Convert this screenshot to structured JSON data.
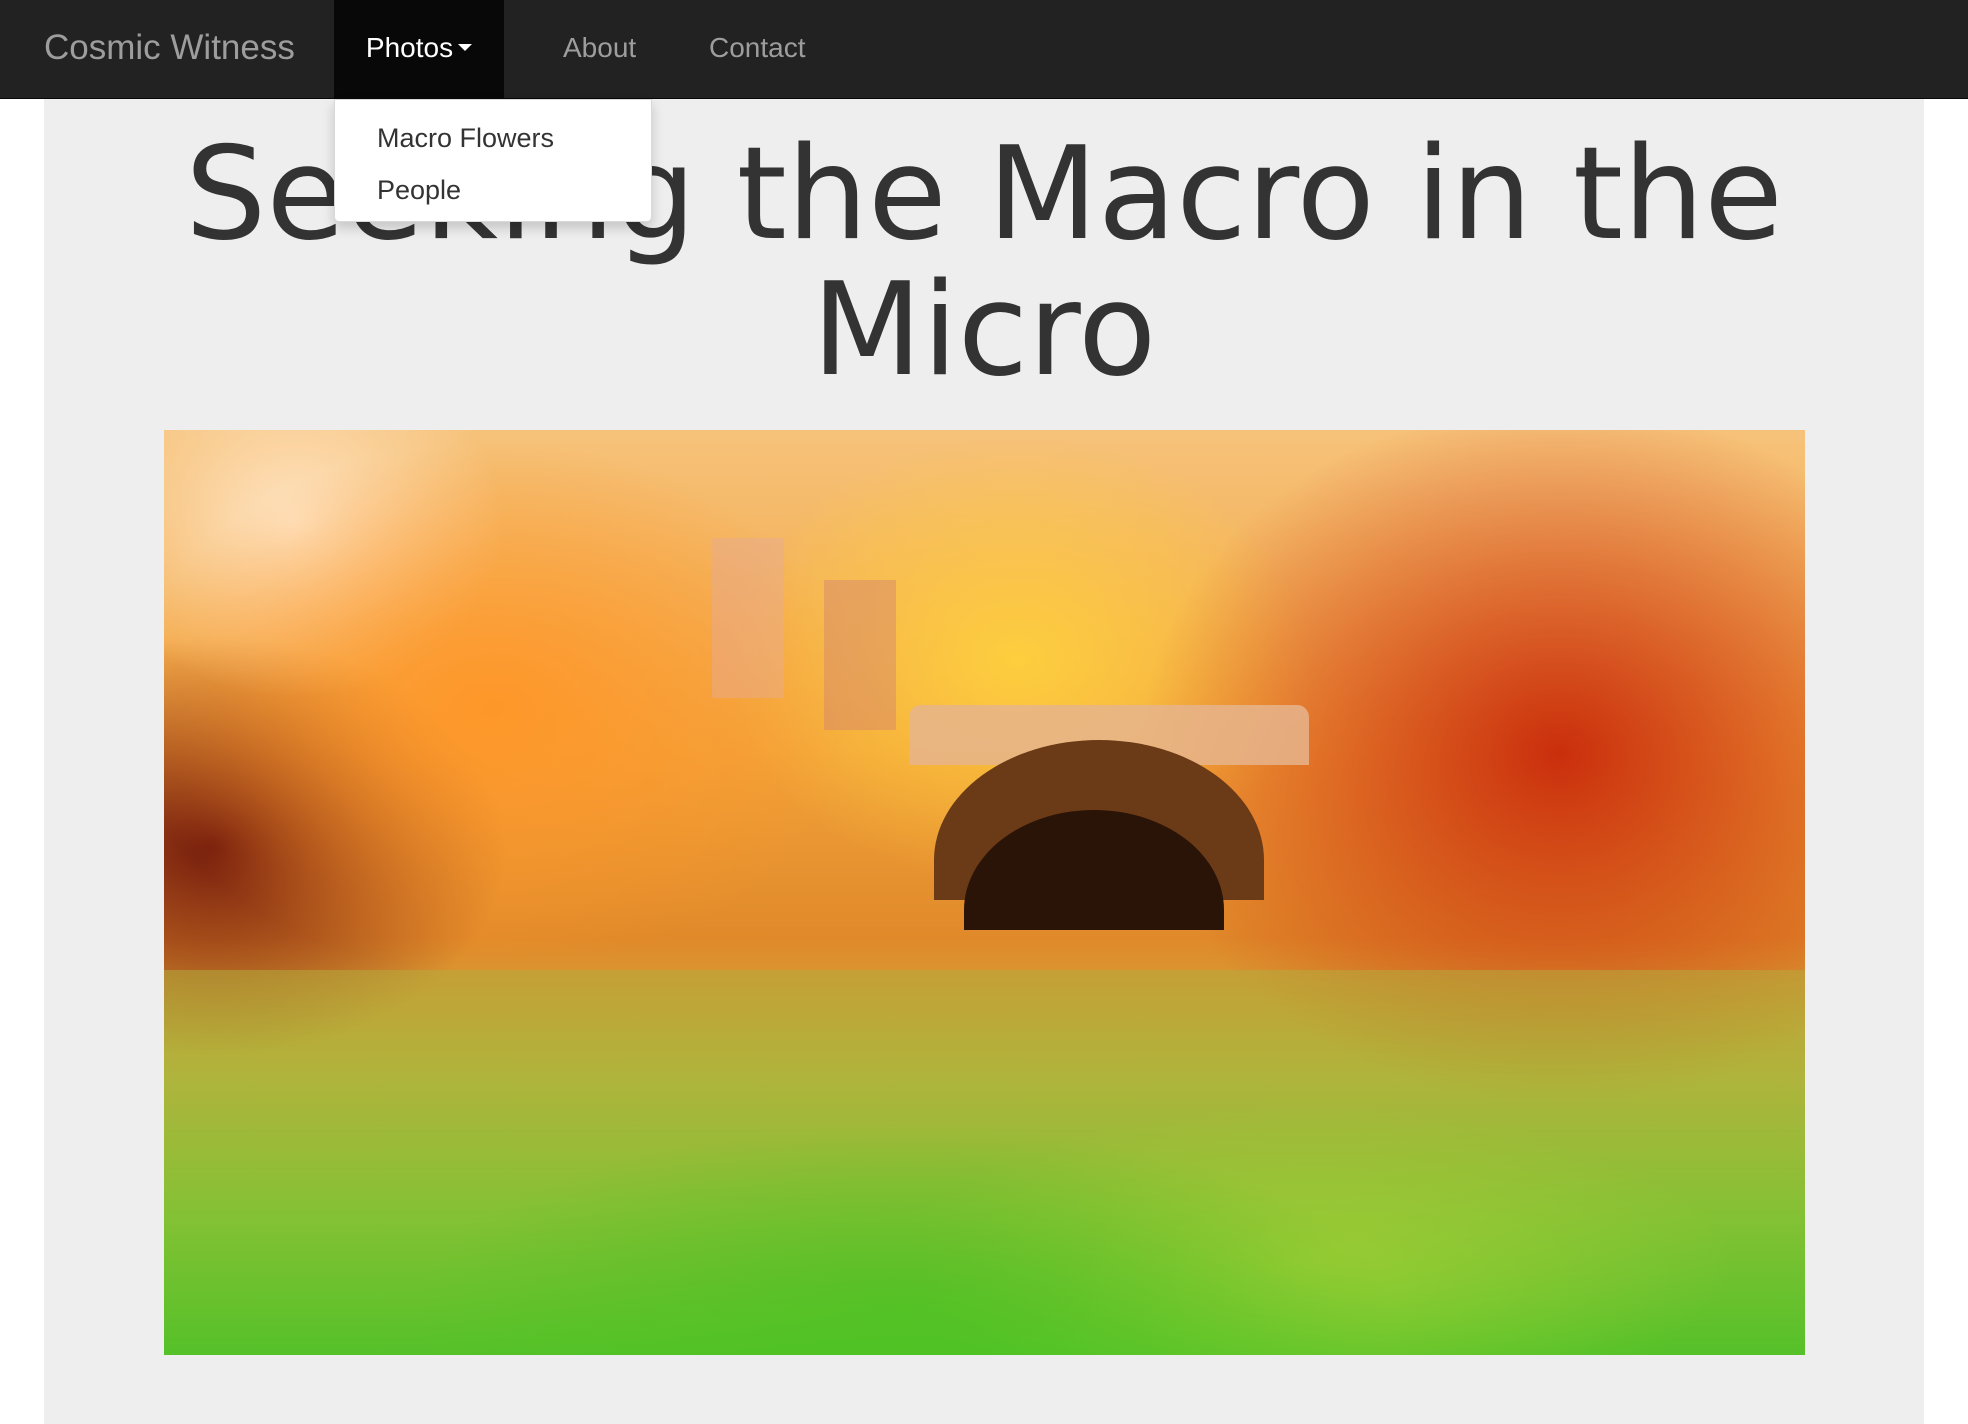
{
  "navbar": {
    "brand": "Cosmic Witness",
    "items": [
      {
        "label": "Photos",
        "active": true,
        "has_caret": true
      },
      {
        "label": "About"
      },
      {
        "label": "Contact"
      }
    ]
  },
  "dropdown": {
    "items": [
      {
        "label": "Macro Flowers"
      },
      {
        "label": "People"
      }
    ]
  },
  "main": {
    "headline": "Seeking the Macro in the Micro"
  },
  "colors": {
    "navbar_bg": "#222222",
    "navbar_active_bg": "#080808",
    "nav_text": "#9d9d9d",
    "jumbotron_bg": "#eeeeee",
    "headline_text": "#333333"
  }
}
